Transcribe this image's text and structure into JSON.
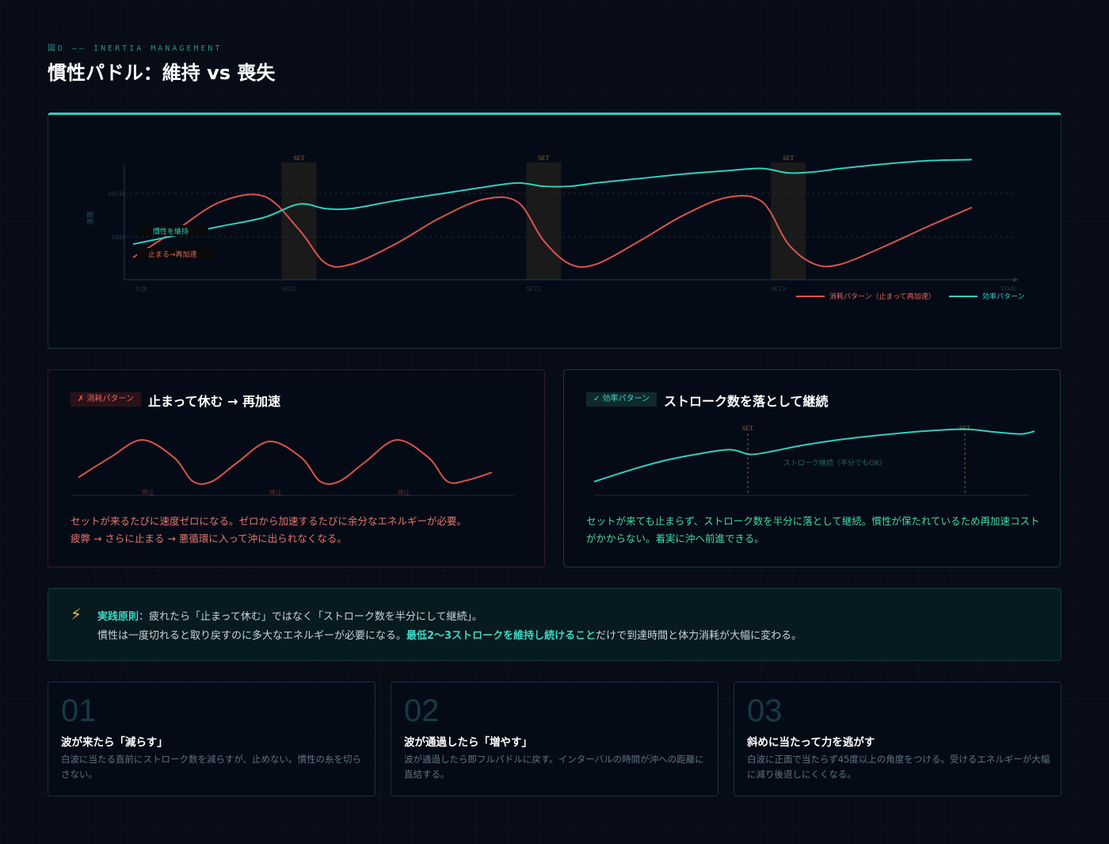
{
  "header": {
    "eyebrow": "図D —— INERTIA MANAGEMENT",
    "title": "慣性パドル：維持 vs 喪失"
  },
  "colors": {
    "accent": "#2fd0bd",
    "waste": "#d9534f",
    "efficient": "#2fd0bd",
    "set_band": "#1a1a1a"
  },
  "chart_data": [
    {
      "type": "line",
      "title": "",
      "xlabel": "TIME →",
      "ylabel": "速度",
      "x_ticks": [
        "入水",
        "SET1",
        "SET2",
        "SET3"
      ],
      "y_ticks": [
        "HIGH",
        "MID"
      ],
      "set_labels": [
        "SET",
        "SET",
        "SET"
      ],
      "ylim": [
        0,
        1
      ],
      "xlim": [
        0,
        10
      ],
      "legend": "bottom-right",
      "grid": true,
      "set_bands": [
        [
          1.7,
          2.1
        ],
        [
          4.5,
          4.9
        ],
        [
          7.3,
          7.7
        ]
      ],
      "annotations": [
        {
          "text": "慣性を維持",
          "x": 0.3,
          "y": 0.37,
          "series": "efficient"
        },
        {
          "text": "止まる→再加速",
          "x": 0.3,
          "y": 0.16,
          "series": "waste"
        }
      ],
      "series": [
        {
          "name": "消耗パターン（止まって再加速）",
          "key": "waste",
          "x": [
            0,
            0.5,
            1.0,
            1.5,
            1.9,
            2.2,
            2.5,
            3.0,
            3.5,
            4.0,
            4.4,
            4.7,
            5.0,
            5.3,
            5.8,
            6.3,
            6.8,
            7.2,
            7.5,
            7.8,
            8.1,
            8.6,
            9.1,
            9.6
          ],
          "y": [
            0.2,
            0.45,
            0.7,
            0.75,
            0.45,
            0.15,
            0.14,
            0.32,
            0.55,
            0.72,
            0.7,
            0.35,
            0.14,
            0.14,
            0.35,
            0.58,
            0.74,
            0.7,
            0.32,
            0.14,
            0.14,
            0.3,
            0.48,
            0.65
          ]
        },
        {
          "name": "効率パターン",
          "key": "efficient",
          "x": [
            0,
            0.5,
            1.0,
            1.5,
            1.9,
            2.2,
            2.5,
            3.0,
            3.5,
            4.0,
            4.4,
            4.7,
            5.0,
            5.3,
            5.8,
            6.3,
            6.8,
            7.2,
            7.5,
            7.8,
            8.1,
            8.6,
            9.1,
            9.6
          ],
          "y": [
            0.32,
            0.4,
            0.48,
            0.56,
            0.68,
            0.64,
            0.64,
            0.71,
            0.77,
            0.83,
            0.87,
            0.84,
            0.84,
            0.87,
            0.91,
            0.95,
            0.98,
            1.0,
            0.96,
            0.97,
            1.0,
            1.04,
            1.07,
            1.08
          ]
        }
      ]
    },
    {
      "type": "line",
      "title": "",
      "stop_labels": [
        "停止",
        "停止",
        "停止"
      ],
      "series": [
        {
          "key": "waste-mini",
          "x": [
            0,
            1,
            2,
            3,
            3.6,
            4.2,
            5,
            6,
            7,
            7.6,
            8.2,
            9,
            10,
            11,
            11.6,
            12.2,
            13
          ],
          "y": [
            0.2,
            0.6,
            0.95,
            0.6,
            0.12,
            0.12,
            0.5,
            0.92,
            0.6,
            0.12,
            0.12,
            0.5,
            0.95,
            0.6,
            0.12,
            0.14,
            0.3
          ]
        }
      ]
    },
    {
      "type": "line",
      "title": "",
      "set_labels": [
        "SET",
        "SET"
      ],
      "annotations": [
        {
          "text": "ストローク継続（半分でもOK）"
        }
      ],
      "series": [
        {
          "key": "efficient-mini",
          "x": [
            0,
            1,
            2,
            3,
            4,
            4.6,
            5.2,
            6,
            7,
            8,
            9,
            10,
            11,
            11.8,
            12.6,
            13
          ],
          "y": [
            0.2,
            0.36,
            0.5,
            0.6,
            0.67,
            0.6,
            0.64,
            0.72,
            0.8,
            0.86,
            0.91,
            0.95,
            0.97,
            0.93,
            0.9,
            0.94
          ]
        }
      ]
    }
  ],
  "card_bad": {
    "badge": "✗ 消耗パターン",
    "title": "止まって休む → 再加速",
    "desc1": "セットが来るたびに速度ゼロになる。ゼロから加速するたびに余分なエネルギーが必要。",
    "desc2": "疲弊 → さらに止まる → 悪循環に入って沖に出られなくなる。"
  },
  "card_good": {
    "badge": "✓ 効率パターン",
    "title": "ストローク数を落として継続",
    "desc1": "セットが来ても止まらず、ストローク数を半分に落として継続。慣性が保たれているため再加速コスト",
    "desc2": "がかからない。着実に沖へ前進できる。"
  },
  "principle": {
    "label": "実践原則",
    "line1": "：疲れたら「止まって休む」ではなく「ストローク数を半分にして継続」。",
    "line2_a": "慣性は一度切れると取り戻すのに多大なエネルギーが必要になる。",
    "line2_strong": "最低2〜3ストロークを維持し続けること",
    "line2_b": "だけで到達時間と体力消耗が大幅に変わる。"
  },
  "tips": [
    {
      "num": "01",
      "title": "波が来たら「減らす」",
      "desc": "白波に当たる直前にストローク数を減らすが、止めない。慣性の糸を切らさない。"
    },
    {
      "num": "02",
      "title": "波が通過したら「増やす」",
      "desc": "波が通過したら即フルパドルに戻す。インターバルの時間が沖への距離に直結する。"
    },
    {
      "num": "03",
      "title": "斜めに当たって力を逃がす",
      "desc": "白波に正面で当たらず45度以上の角度をつける。受けるエネルギーが大幅に減り後退しにくくなる。"
    }
  ]
}
